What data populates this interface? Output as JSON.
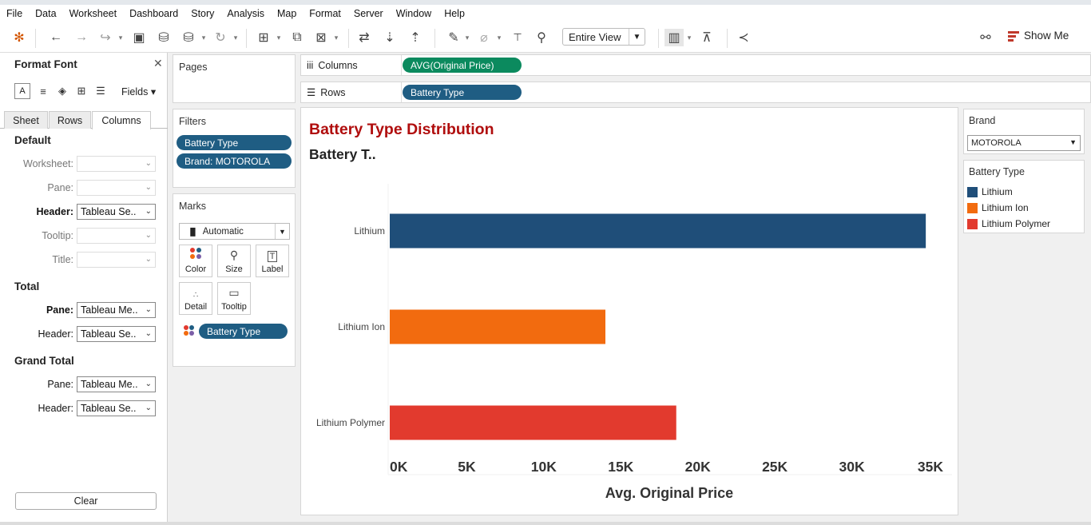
{
  "menu": [
    "File",
    "Data",
    "Worksheet",
    "Dashboard",
    "Story",
    "Analysis",
    "Map",
    "Format",
    "Server",
    "Window",
    "Help"
  ],
  "toolbar": {
    "fit_label": "Entire View",
    "show_me": "Show Me"
  },
  "format_pane": {
    "title": "Format Font",
    "fields_label": "Fields",
    "tabs": [
      "Sheet",
      "Rows",
      "Columns"
    ],
    "active_tab": "Columns",
    "sections": {
      "default": {
        "title": "Default",
        "worksheet": "Worksheet:",
        "pane": "Pane:",
        "header": "Header:",
        "header_value": "Tableau Se..",
        "tooltip": "Tooltip:",
        "title_label": "Title:"
      },
      "total": {
        "title": "Total",
        "pane": "Pane:",
        "pane_value": "Tableau Me..",
        "header": "Header:",
        "header_value": "Tableau Se.."
      },
      "grand_total": {
        "title": "Grand Total",
        "pane": "Pane:",
        "pane_value": "Tableau Me..",
        "header": "Header:",
        "header_value": "Tableau Se.."
      }
    },
    "clear_label": "Clear"
  },
  "pages": {
    "title": "Pages"
  },
  "filters": {
    "title": "Filters",
    "items": [
      "Battery Type",
      "Brand: MOTOROLA"
    ]
  },
  "marks": {
    "title": "Marks",
    "type": "Automatic",
    "buttons": [
      "Color",
      "Size",
      "Label",
      "Detail",
      "Tooltip"
    ],
    "color_field": "Battery Type"
  },
  "shelves": {
    "columns_label": "Columns",
    "columns_pill": "AVG(Original Price)",
    "rows_label": "Rows",
    "rows_pill": "Battery Type"
  },
  "view": {
    "title": "Battery Type Distribution",
    "header": "Battery T.."
  },
  "chart_data": {
    "type": "bar",
    "orientation": "horizontal",
    "categories": [
      "Lithium",
      "Lithium Ion",
      "Lithium Polymer"
    ],
    "values": [
      34800,
      14000,
      18600
    ],
    "colors": [
      "#1f4e79",
      "#f26b0f",
      "#e23a2e"
    ],
    "xlabel": "Avg. Original Price",
    "ylabel": "",
    "xlim": [
      0,
      35000
    ],
    "xticks": [
      "0K",
      "5K",
      "10K",
      "15K",
      "20K",
      "25K",
      "30K",
      "35K"
    ]
  },
  "brand_filter": {
    "title": "Brand",
    "value": "MOTOROLA"
  },
  "legend": {
    "title": "Battery Type",
    "items": [
      {
        "label": "Lithium",
        "color": "#1f4e79"
      },
      {
        "label": "Lithium Ion",
        "color": "#f26b0f"
      },
      {
        "label": "Lithium Polymer",
        "color": "#e23a2e"
      }
    ]
  }
}
